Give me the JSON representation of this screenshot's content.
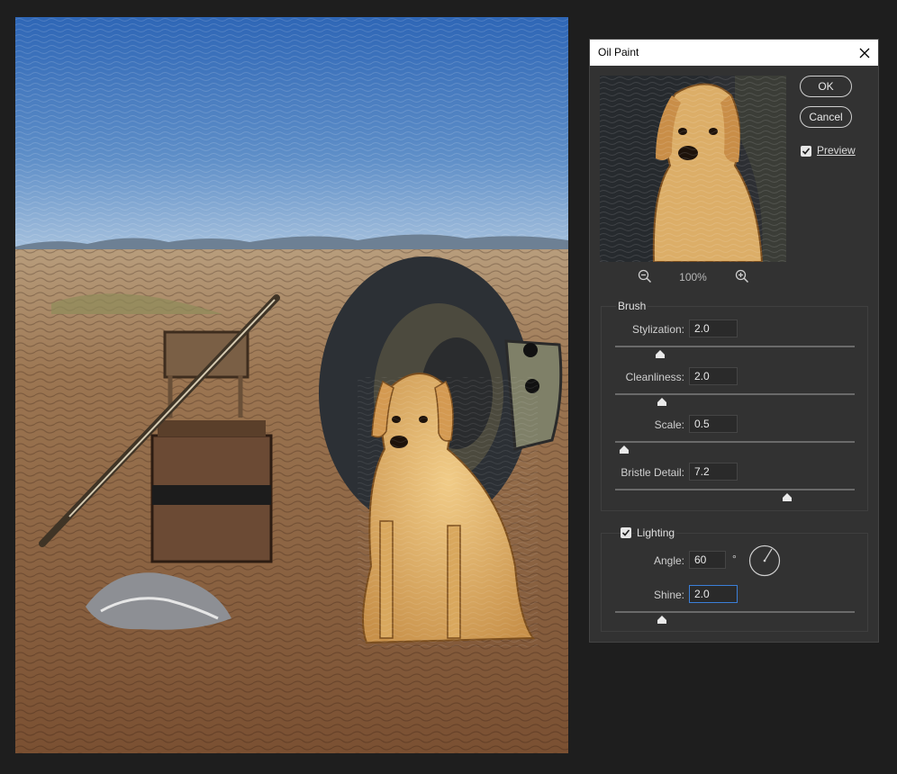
{
  "dialog": {
    "title": "Oil Paint",
    "ok_label": "OK",
    "cancel_label": "Cancel",
    "preview_label": "Preview",
    "preview_checked": true,
    "zoom_level": "100%"
  },
  "brush": {
    "group_label": "Brush",
    "stylization": {
      "label": "Stylization:",
      "value": "2.0"
    },
    "cleanliness": {
      "label": "Cleanliness:",
      "value": "2.0"
    },
    "scale": {
      "label": "Scale:",
      "value": "0.5"
    },
    "bristle_detail": {
      "label": "Bristle Detail:",
      "value": "7.2"
    }
  },
  "lighting": {
    "group_label": "Lighting",
    "enabled": true,
    "angle": {
      "label": "Angle:",
      "value": "60",
      "unit": "°"
    },
    "shine": {
      "label": "Shine:",
      "value": "2.0"
    }
  },
  "colors": {
    "dialog_bg": "#323232",
    "focus_blue": "#3b7fd8",
    "sky": "#3a6fb0",
    "ground": "#8a6040",
    "dog": "#d9a85e",
    "tire": "#2c3035"
  },
  "icons": [
    "close-icon",
    "zoom-out-icon",
    "zoom-in-icon",
    "checkmark-icon",
    "angle-dial-icon",
    "slider-thumb-icon"
  ]
}
